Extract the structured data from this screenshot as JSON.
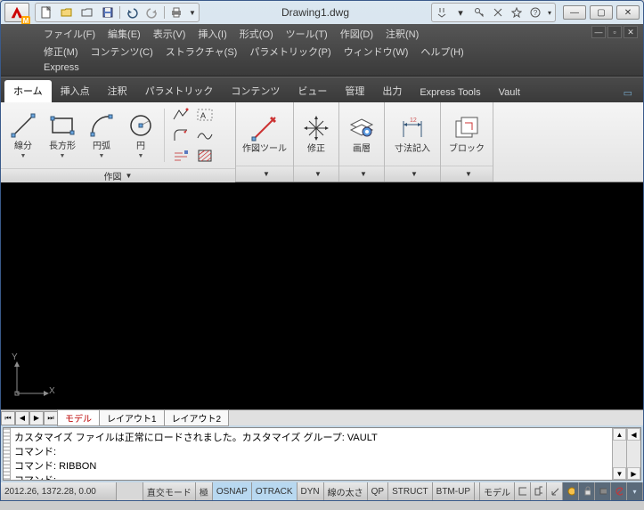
{
  "title": "Drawing1.dwg",
  "qat": {
    "new": "□",
    "open": "▷",
    "save": "💾",
    "undo": "↶",
    "redo": "↷",
    "print": "⎙"
  },
  "titleRight": [
    "⌕",
    "⌕",
    "⚙",
    "☆",
    "?",
    "▾"
  ],
  "winControls": {
    "min": "—",
    "max": "▢",
    "close": "✕"
  },
  "menu": {
    "row1": [
      "ファイル(F)",
      "編集(E)",
      "表示(V)",
      "挿入(I)",
      "形式(O)",
      "ツール(T)",
      "作図(D)",
      "注釈(N)"
    ],
    "row2": [
      "修正(M)",
      "コンテンツ(C)",
      "ストラクチャ(S)",
      "パラメトリック(P)",
      "ウィンドウ(W)",
      "ヘルプ(H)"
    ],
    "row3": [
      "Express"
    ]
  },
  "tabs": [
    "ホーム",
    "挿入点",
    "注釈",
    "パラメトリック",
    "コンテンツ",
    "ビュー",
    "管理",
    "出力",
    "Express Tools",
    "Vault"
  ],
  "activeTab": 0,
  "ribbon": {
    "draw": {
      "title": "作図",
      "line": "線分",
      "rect": "長方形",
      "arc": "円弧",
      "circle": "円"
    },
    "drawtools": "作図ツール",
    "modify": "修正",
    "layers": "画層",
    "dim": "寸法記入",
    "block": "ブロック"
  },
  "sheetTabs": [
    "モデル",
    "レイアウト1",
    "レイアウト2"
  ],
  "cmd": {
    "l1": "カスタマイズ ファイルは正常にロードされました。カスタマイズ グループ: VAULT",
    "l2": "コマンド:",
    "l3": "コマンド: RIBBON",
    "l4": "コマンド:"
  },
  "status": {
    "coords": "2012.26, 1372.28, 0.00",
    "cells": [
      "直交モード",
      "極",
      "OSNAP",
      "OTRACK",
      "DYN",
      "線の太さ",
      "QP",
      "STRUCT",
      "BTM-UP"
    ],
    "hl": [
      2,
      3
    ],
    "model": "モデル"
  },
  "ucs": {
    "x": "X",
    "y": "Y"
  }
}
